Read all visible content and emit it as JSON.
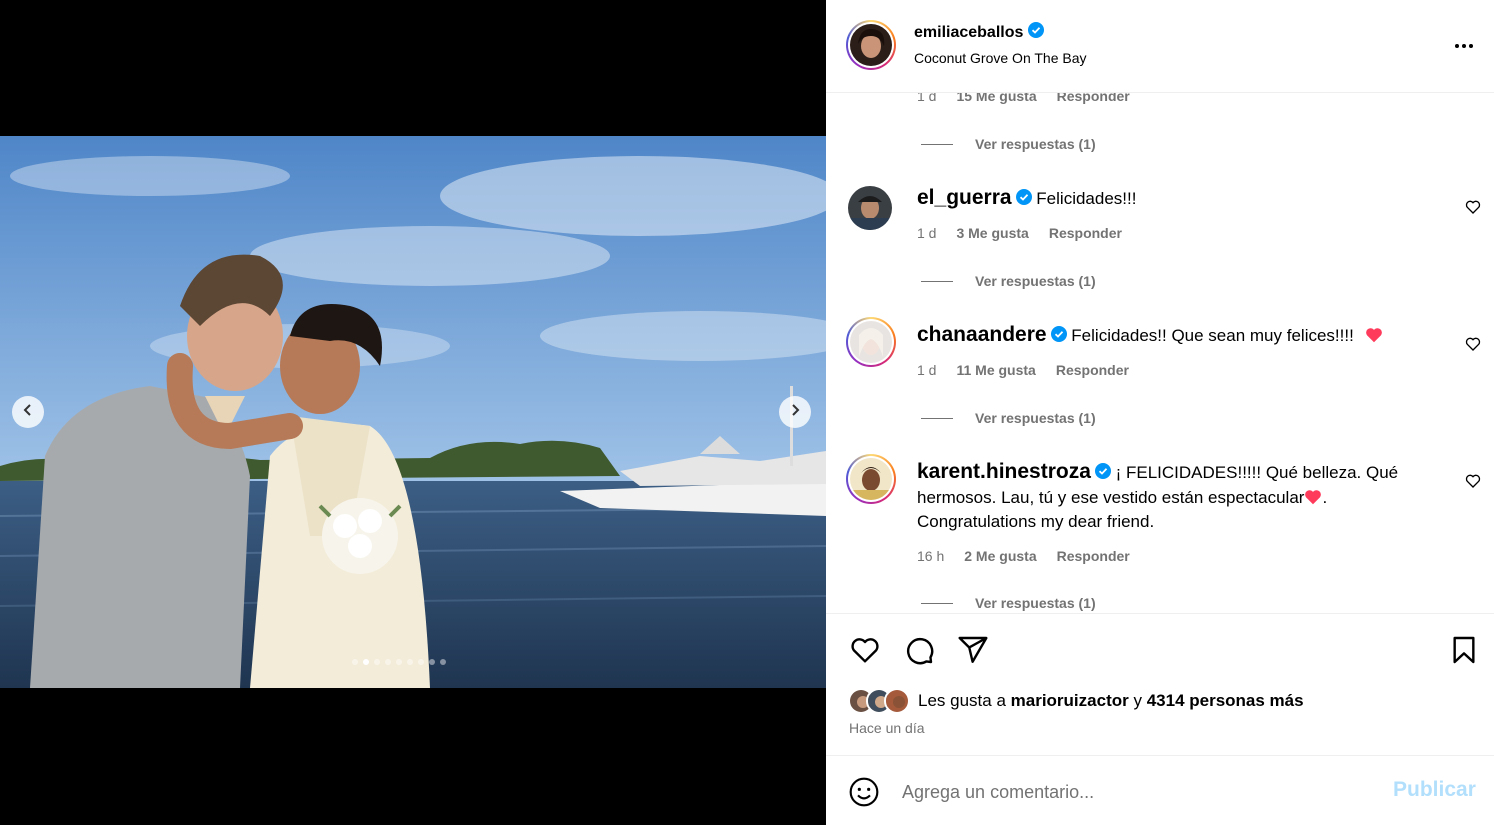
{
  "post": {
    "username": "emiliaceballos",
    "location": "Coconut Grove On The Bay",
    "carousel_total": 9,
    "carousel_active": 2
  },
  "comments": {
    "first_meta": {
      "time": "1 d",
      "likes": "15 Me gusta",
      "reply": "Responder"
    },
    "view_replies": "Ver respuestas (1)",
    "items": [
      {
        "username": "el_guerra",
        "text": "Felicidades!!!",
        "time": "1 d",
        "likes": "3 Me gusta",
        "reply": "Responder",
        "replies": "Ver respuestas (1)"
      },
      {
        "username": "chanaandere",
        "text": "Felicidades!! Que sean muy felices!!!!",
        "time": "1 d",
        "likes": "11 Me gusta",
        "reply": "Responder",
        "replies": "Ver respuestas (1)"
      },
      {
        "username": "karent.hinestroza",
        "text": "¡ FELICIDADES!!!!! Qué belleza. Qué hermosos. Lau, tú y ese vestido están espectacular",
        "text_end": ". Congratulations my dear friend.",
        "time": "16 h",
        "likes": "2 Me gusta",
        "reply": "Responder",
        "replies": "Ver respuestas (1)"
      }
    ]
  },
  "likes": {
    "prefix": "Les gusta a",
    "user": "marioruizactor",
    "connector": "y",
    "others": "4314 personas más"
  },
  "timestamp": "Hace un día",
  "composer": {
    "placeholder": "Agrega un comentario...",
    "publish": "Publicar"
  },
  "colors": {
    "verified": "#0095f6",
    "heart_emoji": "#ff3b5c",
    "publish_disabled": "#b2dffc",
    "muted": "#737373"
  },
  "icons": [
    "verified-badge-icon",
    "more-icon",
    "heart-icon",
    "comment-icon",
    "share-icon",
    "bookmark-icon",
    "emoji-icon",
    "chevron-left-icon",
    "chevron-right-icon"
  ]
}
